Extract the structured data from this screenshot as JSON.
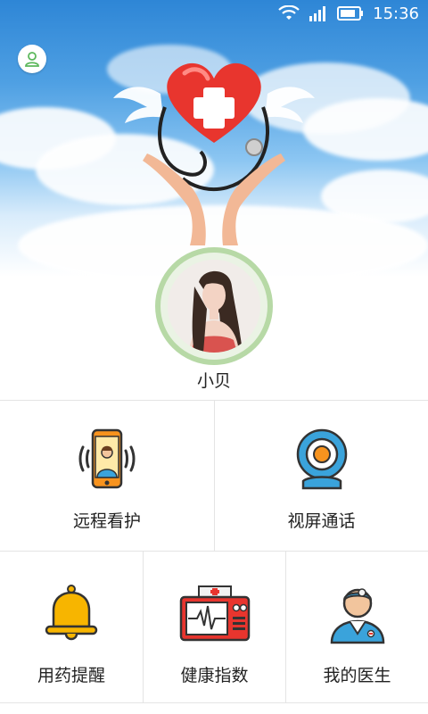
{
  "status_bar": {
    "time": "15:36"
  },
  "profile": {
    "name": "小贝"
  },
  "menu": {
    "row1": [
      {
        "label": "远程看护",
        "icon": "phone-video-icon"
      },
      {
        "label": "视屏通话",
        "icon": "webcam-icon"
      }
    ],
    "row2": [
      {
        "label": "用药提醒",
        "icon": "bell-icon"
      },
      {
        "label": "健康指数",
        "icon": "heart-monitor-icon"
      },
      {
        "label": "我的医生",
        "icon": "doctor-icon"
      }
    ]
  },
  "colors": {
    "ring": "#b7d9a6",
    "accent_orange": "#f7931e",
    "accent_blue": "#3aa3db",
    "heart_red": "#e8352e"
  }
}
